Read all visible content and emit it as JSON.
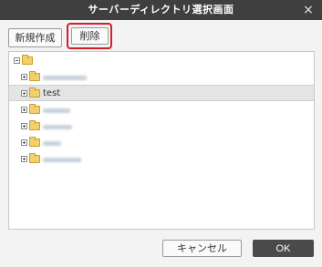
{
  "window": {
    "title": "サーバーディレクトリ選択画面",
    "close_glyph": "×"
  },
  "toolbar": {
    "new_label": "新規作成",
    "delete_label": "削除"
  },
  "tree": {
    "root": {
      "label": ""
    },
    "items": [
      {
        "label": ""
      },
      {
        "label": "test",
        "selected": true
      },
      {
        "label": ""
      },
      {
        "label": ""
      },
      {
        "label": ""
      },
      {
        "label": ""
      }
    ]
  },
  "footer": {
    "cancel_label": "キャンセル",
    "ok_label": "OK"
  },
  "colors": {
    "titlebar": "#3f3f3f",
    "highlight": "#d0202a",
    "folder": "#f4d06a",
    "ok_button": "#4a4a4a"
  }
}
